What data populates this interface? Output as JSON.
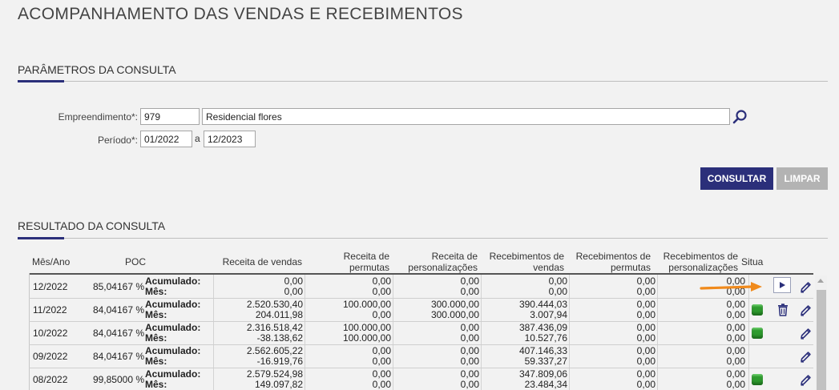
{
  "page": {
    "title": "ACOMPANHAMENTO DAS VENDAS E RECEBIMENTOS"
  },
  "params": {
    "section_title": "PARÂMETROS DA CONSULTA",
    "empreendimento_label": "Empreendimento*:",
    "empreendimento_code": "979",
    "empreendimento_name": "Residencial flores",
    "periodo_label": "Período*:",
    "periodo_start": "01/2022",
    "periodo_sep": "a",
    "periodo_end": "12/2023",
    "consultar": "CONSULTAR",
    "limpar": "LIMPAR"
  },
  "result": {
    "section_title": "RESULTADO DA CONSULTA",
    "columns": {
      "mes_ano": "Mês/Ano",
      "poc": "POC",
      "receita_vendas": "Receita de vendas",
      "receita_permutas_1": "Receita de",
      "receita_permutas_2": "permutas",
      "receita_pers_1": "Receita de",
      "receita_pers_2": "personalizações",
      "receb_vendas_1": "Recebimentos de",
      "receb_vendas_2": "vendas",
      "receb_permutas_1": "Recebimentos de",
      "receb_permutas_2": "permutas",
      "receb_pers_1": "Recebimentos de",
      "receb_pers_2": "personalizações",
      "situacao": "Situa"
    },
    "label_acumulado": "Acumulado:",
    "label_mes": "Mês:",
    "rows": [
      {
        "mes": "12/2022",
        "poc": "85,04167 %",
        "rv": [
          "0,00",
          "0,00"
        ],
        "rp": [
          "0,00",
          "0,00"
        ],
        "rpers": [
          "0,00",
          "0,00"
        ],
        "recv": [
          "0,00",
          "0,00"
        ],
        "recp": [
          "0,00",
          "0,00"
        ],
        "recpers": [
          "0,00",
          "0,00"
        ],
        "status": "none",
        "action": "play"
      },
      {
        "mes": "11/2022",
        "poc": "84,04167 %",
        "rv": [
          "2.520.530,40",
          "204.011,98"
        ],
        "rp": [
          "100.000,00",
          "0,00"
        ],
        "rpers": [
          "300.000,00",
          "300.000,00"
        ],
        "recv": [
          "390.444,03",
          "3.007,94"
        ],
        "recp": [
          "0,00",
          "0,00"
        ],
        "recpers": [
          "0,00",
          "0,00"
        ],
        "status": "green",
        "action": "trash"
      },
      {
        "mes": "10/2022",
        "poc": "84,04167 %",
        "rv": [
          "2.316.518,42",
          "-38.138,62"
        ],
        "rp": [
          "100.000,00",
          "100.000,00"
        ],
        "rpers": [
          "0,00",
          "0,00"
        ],
        "recv": [
          "387.436,09",
          "10.527,76"
        ],
        "recp": [
          "0,00",
          "0,00"
        ],
        "recpers": [
          "0,00",
          "0,00"
        ],
        "status": "green",
        "action": "none"
      },
      {
        "mes": "09/2022",
        "poc": "84,04167 %",
        "rv": [
          "2.562.605,22",
          "-16.919,76"
        ],
        "rp": [
          "0,00",
          "0,00"
        ],
        "rpers": [
          "0,00",
          "0,00"
        ],
        "recv": [
          "407.146,33",
          "59.337,27"
        ],
        "recp": [
          "0,00",
          "0,00"
        ],
        "recpers": [
          "0,00",
          "0,00"
        ],
        "status": "none",
        "action": "none"
      },
      {
        "mes": "08/2022",
        "poc": "99,85000 %",
        "rv": [
          "2.579.524,98",
          "149.097,82"
        ],
        "rp": [
          "0,00",
          "0,00"
        ],
        "rpers": [
          "0,00",
          "0,00"
        ],
        "recv": [
          "347.809,06",
          "23.484,34"
        ],
        "recp": [
          "0,00",
          "0,00"
        ],
        "recpers": [
          "0,00",
          "0,00"
        ],
        "status": "green",
        "action": "none"
      }
    ]
  },
  "colors": {
    "primary": "#2b2f7a",
    "arrow": "#f08a1c",
    "status_ok": "#2e9b2e"
  }
}
